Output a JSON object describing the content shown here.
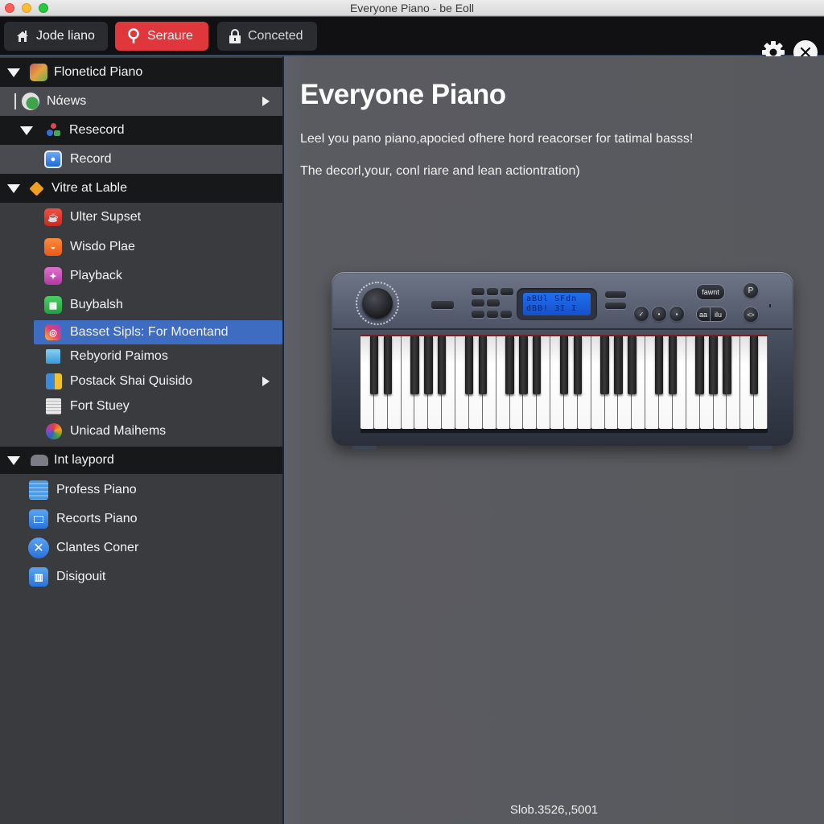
{
  "window": {
    "title": "Everyone Piano - be Eoll"
  },
  "toolbar": {
    "home_label": "Jode liano",
    "search_label": "Seraure",
    "lock_label": "Conceted",
    "accent_color": "#e0373d"
  },
  "sidebar": {
    "rows": [
      {
        "label": "Floneticd Piano",
        "type": "group",
        "icon": "gift-icon",
        "expanded": true
      },
      {
        "label": "Nάews",
        "type": "sub",
        "icon": "globe-icon",
        "has_submenu": true
      },
      {
        "label": "Resecord",
        "type": "group",
        "icon": "shapes-icon",
        "expanded": true
      },
      {
        "label": "Record",
        "type": "sub",
        "icon": "record-icon"
      },
      {
        "label": "Vitre at Lable",
        "type": "group",
        "icon": "diamond-icon",
        "expanded": true
      },
      {
        "label": "Ulter Supset",
        "type": "item",
        "icon": "cup-icon"
      },
      {
        "label": "Wisdo Plae",
        "type": "item",
        "icon": "bread-icon"
      },
      {
        "label": "Playback",
        "type": "item",
        "icon": "dancer-icon"
      },
      {
        "label": "Buybalsh",
        "type": "item",
        "icon": "grid-icon"
      },
      {
        "label": "Basset Sipls: For Moentand",
        "type": "item",
        "icon": "camera-icon",
        "selected": true
      },
      {
        "label": "Rebyorid Paimos",
        "type": "item",
        "icon": "monitor-icon"
      },
      {
        "label": "Postack Shai Quisido",
        "type": "item",
        "icon": "folder-icon",
        "has_submenu": true
      },
      {
        "label": "Fort Stuey",
        "type": "item",
        "icon": "document-icon"
      },
      {
        "label": "Unicad Maihems",
        "type": "item",
        "icon": "palette-icon"
      },
      {
        "label": "Int laypord",
        "type": "group",
        "icon": "cloud-icon",
        "expanded": true
      },
      {
        "label": "Profess Piano",
        "type": "item",
        "icon": "calendar-icon"
      },
      {
        "label": "Recorts Piano",
        "type": "item",
        "icon": "window-icon"
      },
      {
        "label": "Clantes Coner",
        "type": "item",
        "icon": "x-circle-icon"
      },
      {
        "label": "Disigouit",
        "type": "item",
        "icon": "equalizer-icon"
      }
    ],
    "selected_color": "#3d6cc0"
  },
  "main": {
    "title": "Everyone Piano",
    "paragraph_1": "Leel you pano piano,apocied ofhere hord reacorser for tatimal basss!",
    "paragraph_2": "The decorl,your, conl riare and lean actiontration)",
    "footer": "Slob.3526,,5001"
  },
  "keyboard": {
    "lcd_line_1": "aBUl SFdn",
    "lcd_line_2": "dBB! 3I I",
    "button_labels": {
      "favorite": "fawnt",
      "p": "P",
      "pill_left": "aa",
      "pill_right": "ilu",
      "bottom_right": "<>"
    },
    "white_key_count": 30
  }
}
